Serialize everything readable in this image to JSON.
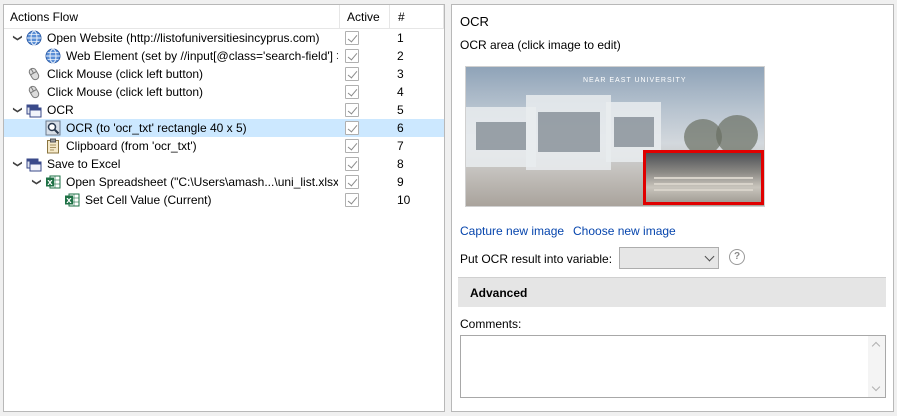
{
  "tree": {
    "headers": {
      "actions": "Actions Flow",
      "active": "Active",
      "num": "#"
    },
    "rows": [
      {
        "num": "1",
        "label": "Open Website (http://listofuniversitiesincyprus.com)",
        "icon": "globe-icon",
        "toggle": "expanded",
        "level": 0
      },
      {
        "num": "2",
        "label": "Web Element (set by //input[@class='search-field'] >",
        "icon": "globe-icon",
        "toggle": "none",
        "level": 1
      },
      {
        "num": "3",
        "label": "Click Mouse (click left button)",
        "icon": "mouse-icon",
        "toggle": "none",
        "level": 0
      },
      {
        "num": "4",
        "label": "Click Mouse (click left button)",
        "icon": "mouse-icon",
        "toggle": "none",
        "level": 0
      },
      {
        "num": "5",
        "label": "OCR",
        "icon": "window-group-icon",
        "toggle": "expanded",
        "level": 0
      },
      {
        "num": "6",
        "label": "OCR (to 'ocr_txt' rectangle 40 x 5)",
        "icon": "ocr-magnifier-icon",
        "toggle": "none",
        "level": 1,
        "selected": true
      },
      {
        "num": "7",
        "label": "Clipboard (from 'ocr_txt')",
        "icon": "clipboard-icon",
        "toggle": "none",
        "level": 1
      },
      {
        "num": "8",
        "label": "Save to Excel",
        "icon": "window-group-icon",
        "toggle": "expanded",
        "level": 0
      },
      {
        "num": "9",
        "label": "Open Spreadsheet (\"C:\\Users\\amash...\\uni_list.xlsx\")",
        "icon": "excel-icon",
        "toggle": "expanded",
        "level": 1
      },
      {
        "num": "10",
        "label": "Set Cell Value (Current)",
        "icon": "excel-icon",
        "toggle": "none",
        "level": 2
      }
    ]
  },
  "detail": {
    "title": "OCR",
    "ocr_area_label": "OCR area (click image to edit)",
    "image_banner": "NEAR EAST UNIVERSITY",
    "capture_link": "Capture new image",
    "choose_link": "Choose new image",
    "variable_label": "Put OCR result into variable:",
    "variable_value": "",
    "advanced_label": "Advanced",
    "comments_label": "Comments:",
    "comments_value": ""
  },
  "colors": {
    "selection": "#cce8ff",
    "link": "#0645ad",
    "ocr_rect": "#e00000"
  }
}
